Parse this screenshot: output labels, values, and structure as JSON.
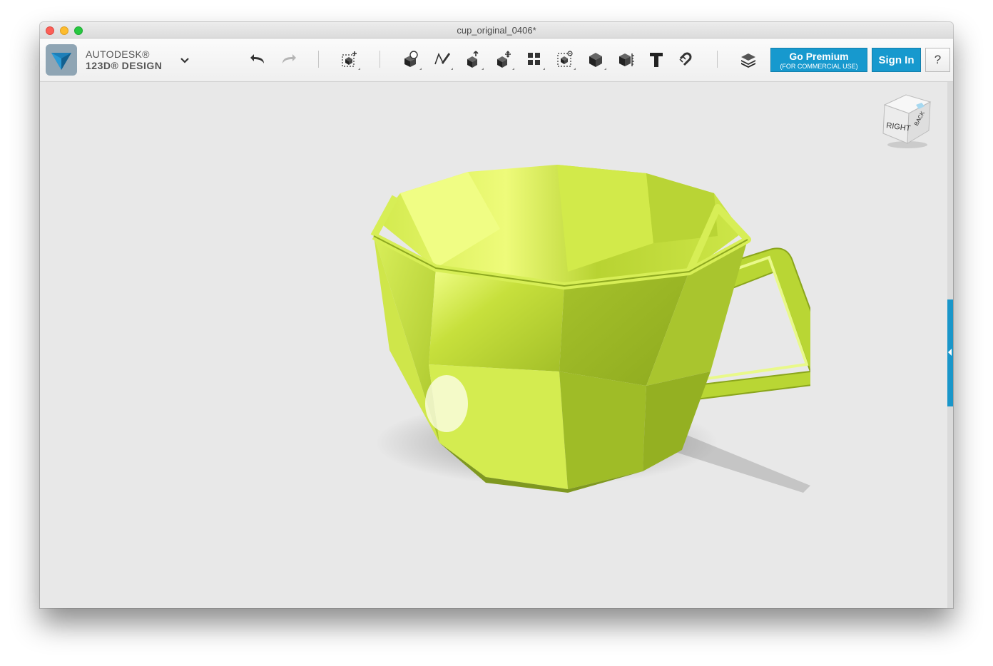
{
  "window": {
    "title": "cup_original_0406*"
  },
  "brand": {
    "line1": "AUTODESK®",
    "line2": "123D® DESIGN",
    "icon": "autodesk-123d-logo"
  },
  "toolbar": {
    "tools": [
      {
        "name": "undo-button",
        "icon": "undo-arrow-icon"
      },
      {
        "name": "redo-button",
        "icon": "redo-arrow-icon"
      },
      {
        "name": "transform-button",
        "icon": "transform-icon"
      },
      {
        "name": "primitives-button",
        "icon": "primitives-icon"
      },
      {
        "name": "sketch-button",
        "icon": "sketch-icon"
      },
      {
        "name": "construct-button",
        "icon": "construct-icon"
      },
      {
        "name": "modify-button",
        "icon": "modify-icon"
      },
      {
        "name": "pattern-button",
        "icon": "pattern-icon"
      },
      {
        "name": "grouping-button",
        "icon": "grouping-icon"
      },
      {
        "name": "combine-button",
        "icon": "combine-icon"
      },
      {
        "name": "measure-button",
        "icon": "measure-icon"
      },
      {
        "name": "text-button",
        "icon": "text-icon"
      },
      {
        "name": "snap-button",
        "icon": "snap-icon"
      },
      {
        "name": "materials-button",
        "icon": "layers-icon"
      }
    ],
    "premium_label": "Go Premium",
    "premium_sublabel": "(FOR COMMERCIAL USE)",
    "signin_label": "Sign In",
    "help_label": "?"
  },
  "viewcube": {
    "face_label": "RIGHT",
    "side_label": "BACK"
  },
  "colors": {
    "accent": "#1799ce",
    "model": "#b8d434"
  }
}
